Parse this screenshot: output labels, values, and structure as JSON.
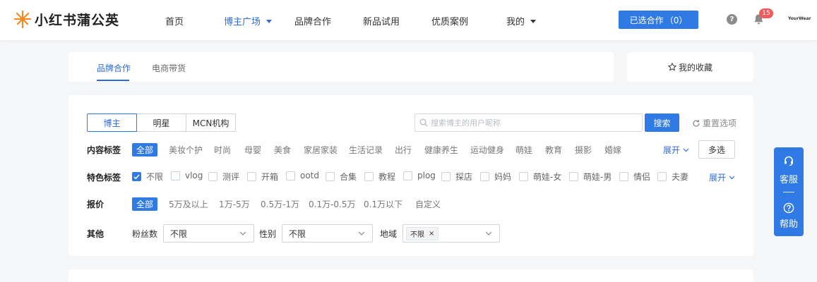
{
  "header": {
    "logo_text": "小红书蒲公英",
    "nav": [
      {
        "label": "首页"
      },
      {
        "label": "博主广场"
      },
      {
        "label": "品牌合作"
      },
      {
        "label": "新品试用"
      },
      {
        "label": "优质案例"
      },
      {
        "label": "我的"
      }
    ],
    "selected_label": "已选合作",
    "selected_count": "（0）",
    "notification_count": "15",
    "brand_tag": "YourWear"
  },
  "tabs": {
    "items": [
      "品牌合作",
      "电商带货"
    ],
    "favorites_label": "我的收藏"
  },
  "filters": {
    "segments": [
      "博主",
      "明星",
      "MCN机构"
    ],
    "search_placeholder": "搜索博主的用户昵称",
    "search_button": "搜索",
    "reset_label": "重置选项",
    "content_tags": {
      "label": "内容标签",
      "items": [
        "全部",
        "美妆个护",
        "时尚",
        "母婴",
        "美食",
        "家居家装",
        "生活记录",
        "出行",
        "健康养生",
        "运动健身",
        "萌娃",
        "教育",
        "摄影",
        "婚嫁"
      ],
      "expand": "展开",
      "multi_select": "多选"
    },
    "feature_tags": {
      "label": "特色标签",
      "items": [
        "不限",
        "vlog",
        "测评",
        "开箱",
        "ootd",
        "合集",
        "教程",
        "plog",
        "探店",
        "妈妈",
        "萌娃-女",
        "萌娃-男",
        "情侣",
        "夫妻"
      ],
      "expand": "展开"
    },
    "price": {
      "label": "报价",
      "items": [
        "全部",
        "5万及以上",
        "1万-5万",
        "0.5万-1万",
        "0.1万-0.5万",
        "0.1万以下",
        "自定义"
      ]
    },
    "other": {
      "label": "其他",
      "fans_label": "粉丝数",
      "fans_value": "不限",
      "gender_label": "性别",
      "gender_value": "不限",
      "region_label": "地域",
      "region_tag": "不限",
      "region_tag_close": "×"
    }
  },
  "side_widget": {
    "service_label": "客服",
    "help_label": "帮助"
  },
  "colors": {
    "accent": "#2f7ae5",
    "active_text": "#2f6bd6",
    "badge": "#f25b5b",
    "logo_orange": "#f08a24"
  }
}
